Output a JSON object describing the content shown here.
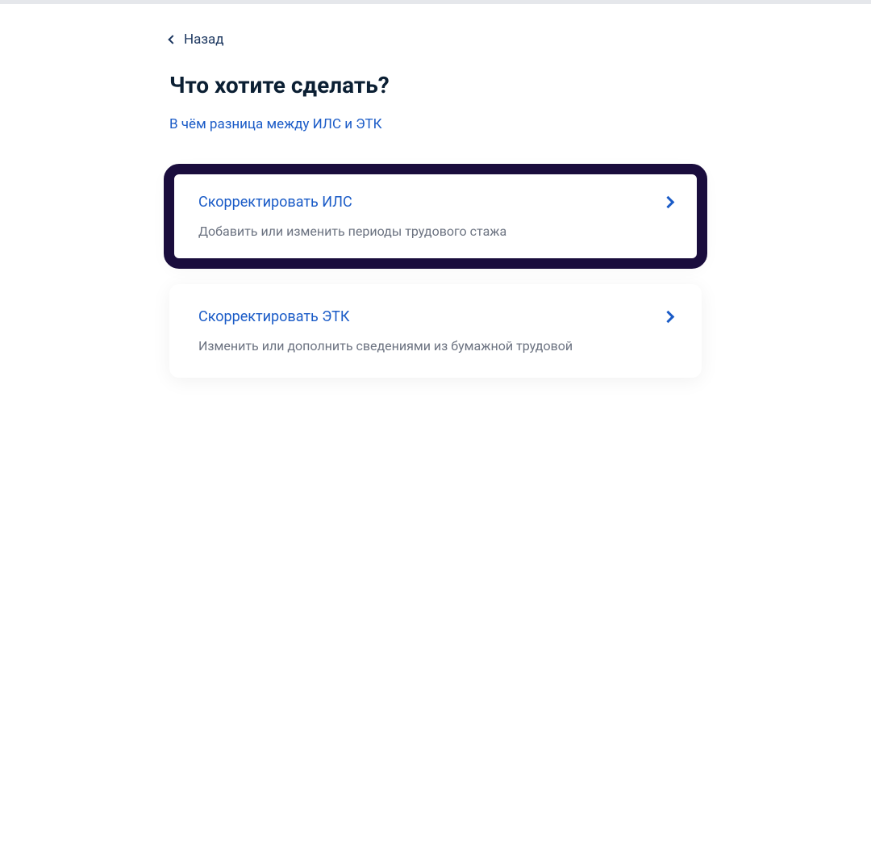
{
  "navigation": {
    "back_label": "Назад"
  },
  "page": {
    "title": "Что хотите сделать?",
    "info_link": "В чём разница между ИЛС и ЭТК"
  },
  "cards": [
    {
      "title": "Скорректировать ИЛС",
      "description": "Добавить или изменить периоды трудового стажа",
      "highlighted": true
    },
    {
      "title": "Скорректировать ЭТК",
      "description": "Изменить или дополнить сведениями из бумажной трудовой",
      "highlighted": false
    }
  ]
}
